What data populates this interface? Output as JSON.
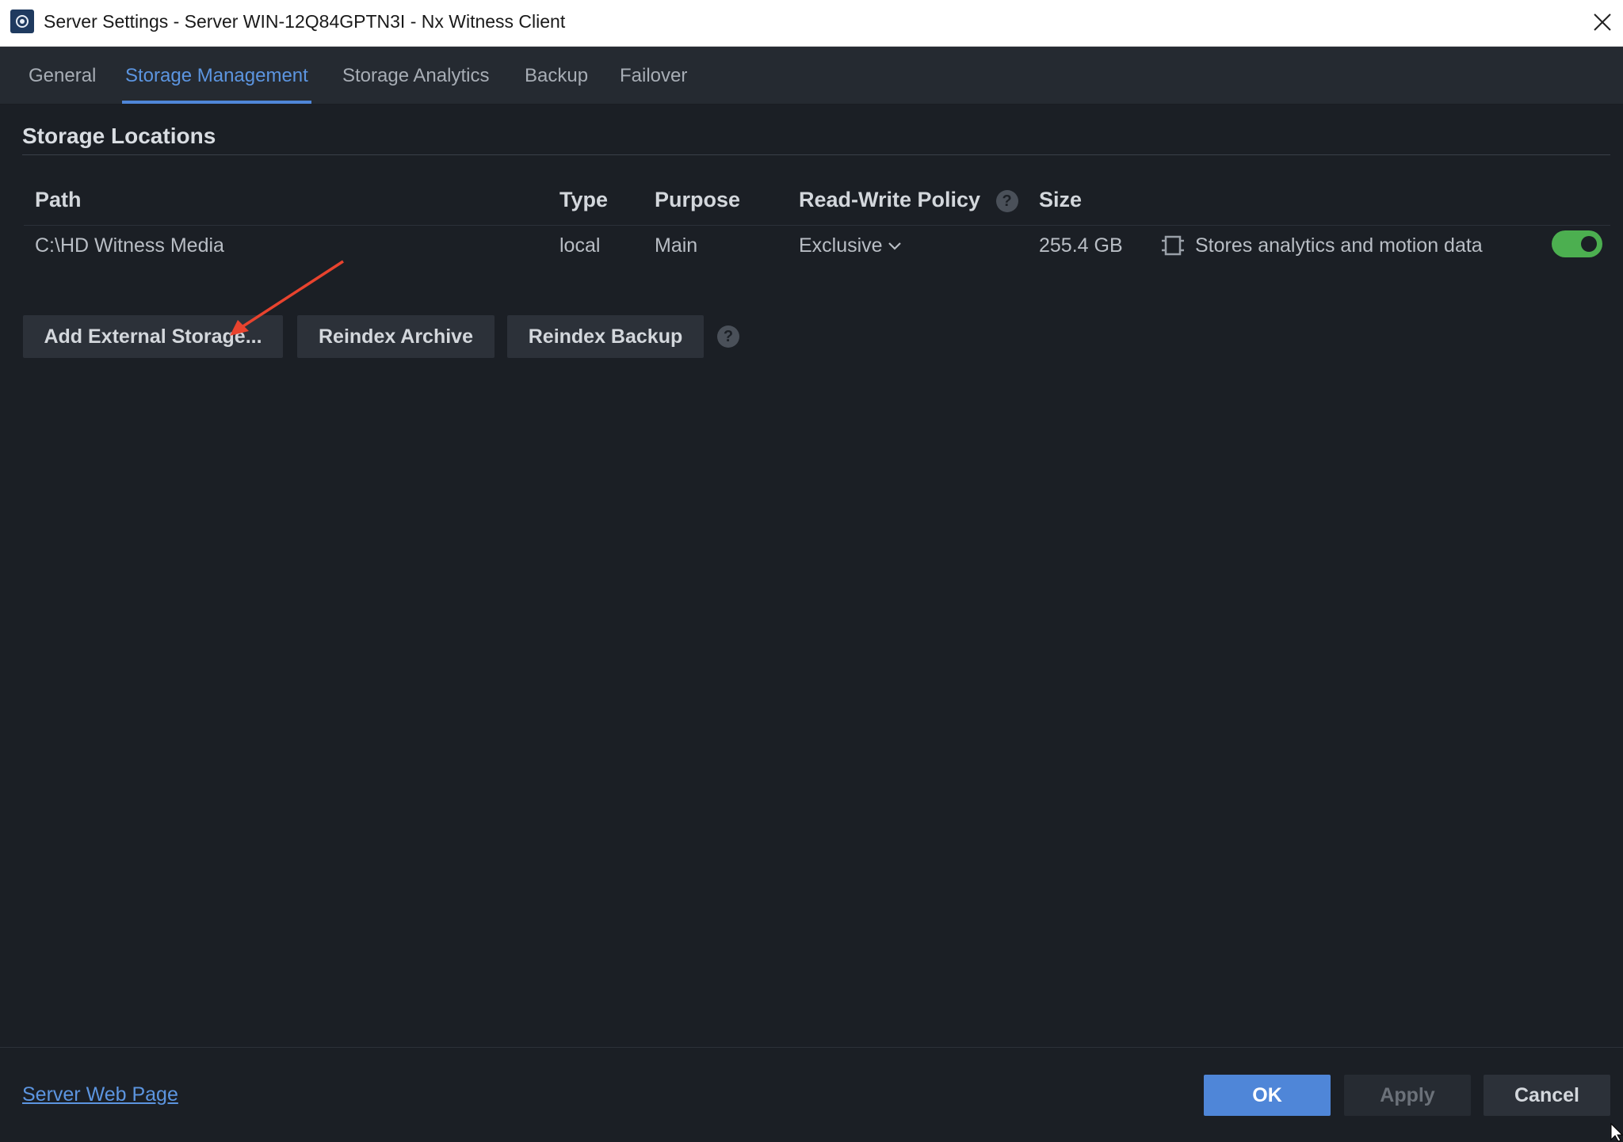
{
  "window": {
    "title": "Server Settings - Server WIN-12Q84GPTN3I - Nx Witness Client"
  },
  "tabs": [
    {
      "label": "General",
      "active": false
    },
    {
      "label": "Storage Management",
      "active": true
    },
    {
      "label": "Storage Analytics",
      "active": false
    },
    {
      "label": "Backup",
      "active": false
    },
    {
      "label": "Failover",
      "active": false
    }
  ],
  "storage": {
    "section_title": "Storage Locations",
    "columns": {
      "path": "Path",
      "type": "Type",
      "purpose": "Purpose",
      "policy": "Read-Write Policy",
      "size": "Size"
    },
    "rows": [
      {
        "path": "C:\\HD Witness Media",
        "type": "local",
        "purpose": "Main",
        "policy": "Exclusive",
        "size": "255.4 GB",
        "analytics_label": "Stores analytics and motion data",
        "enabled": true
      }
    ],
    "help_glyph": "?"
  },
  "actions": {
    "add_external": "Add External Storage...",
    "reindex_archive": "Reindex Archive",
    "reindex_backup": "Reindex Backup",
    "help_glyph": "?"
  },
  "footer": {
    "web_link": "Server Web Page",
    "ok": "OK",
    "apply": "Apply",
    "cancel": "Cancel"
  },
  "colors": {
    "accent": "#4f86d8",
    "toggle_on": "#4caf50",
    "annotation_arrow": "#e8432e",
    "background": "#1b1f25"
  },
  "icons": [
    "app-logo-icon",
    "close-icon",
    "help-icon",
    "chevron-down-icon",
    "analytics-chip-icon",
    "annotation-arrow-icon",
    "mouse-cursor-icon"
  ]
}
